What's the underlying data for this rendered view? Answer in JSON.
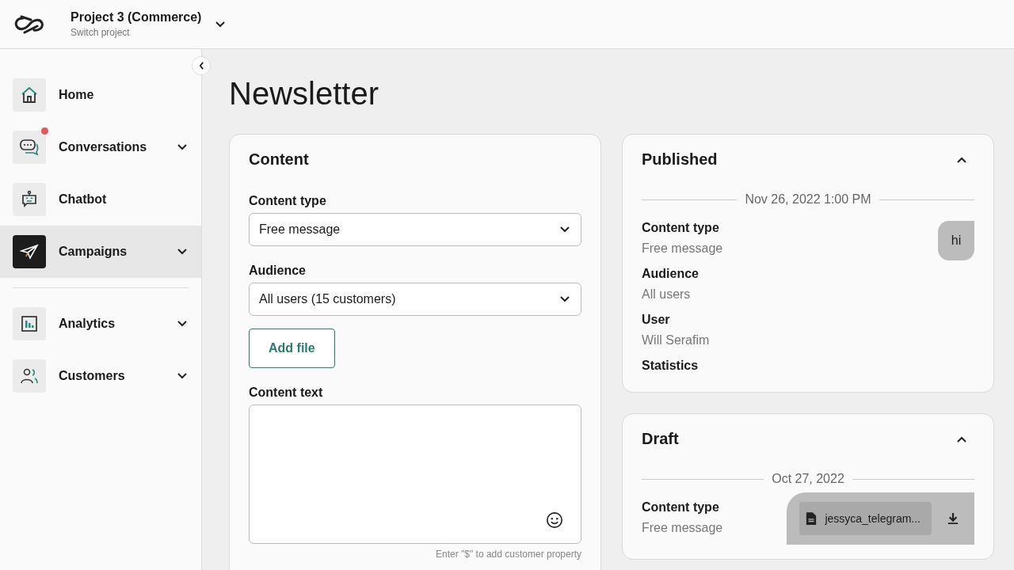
{
  "header": {
    "project_name": "Project 3 (Commerce)",
    "project_subtitle": "Switch project"
  },
  "sidebar": {
    "sections": [
      {
        "items": [
          {
            "label": "Home",
            "selected": false,
            "expandable": false,
            "notification": false
          },
          {
            "label": "Conversations",
            "selected": false,
            "expandable": true,
            "notification": true
          },
          {
            "label": "Chatbot",
            "selected": false,
            "expandable": false,
            "notification": false
          },
          {
            "label": "Campaigns",
            "selected": true,
            "expandable": true,
            "notification": false
          }
        ]
      },
      {
        "items": [
          {
            "label": "Analytics",
            "selected": false,
            "expandable": true,
            "notification": false
          },
          {
            "label": "Customers",
            "selected": false,
            "expandable": true,
            "notification": false
          }
        ]
      }
    ]
  },
  "page_title": "Newsletter",
  "content_card": {
    "title": "Content",
    "fields": [
      {
        "label": "Content type",
        "value": "Free message"
      },
      {
        "label": "Audience",
        "value": "All users (15 customers)"
      }
    ],
    "add_file_button": "Add file",
    "text_label": "Content text",
    "hint": "Enter \"$\" to add customer property"
  },
  "history": [
    {
      "title": "Published",
      "expanded": true,
      "date": "Nov 26, 2022 1:00 PM",
      "details": [
        {
          "label": "Content type",
          "value": "Free message"
        },
        {
          "label": "Audience",
          "value": "All users"
        },
        {
          "label": "User",
          "value": "Will Serafim"
        },
        {
          "label": "Statistics"
        }
      ],
      "preview": {
        "kind": "bubble",
        "text": "hi"
      }
    },
    {
      "title": "Draft",
      "expanded": true,
      "date": "Oct 27, 2022",
      "details": [
        {
          "label": "Content type",
          "value": "Free message"
        }
      ],
      "preview": {
        "kind": "file",
        "text": "jessyca_telegram..."
      }
    }
  ]
}
